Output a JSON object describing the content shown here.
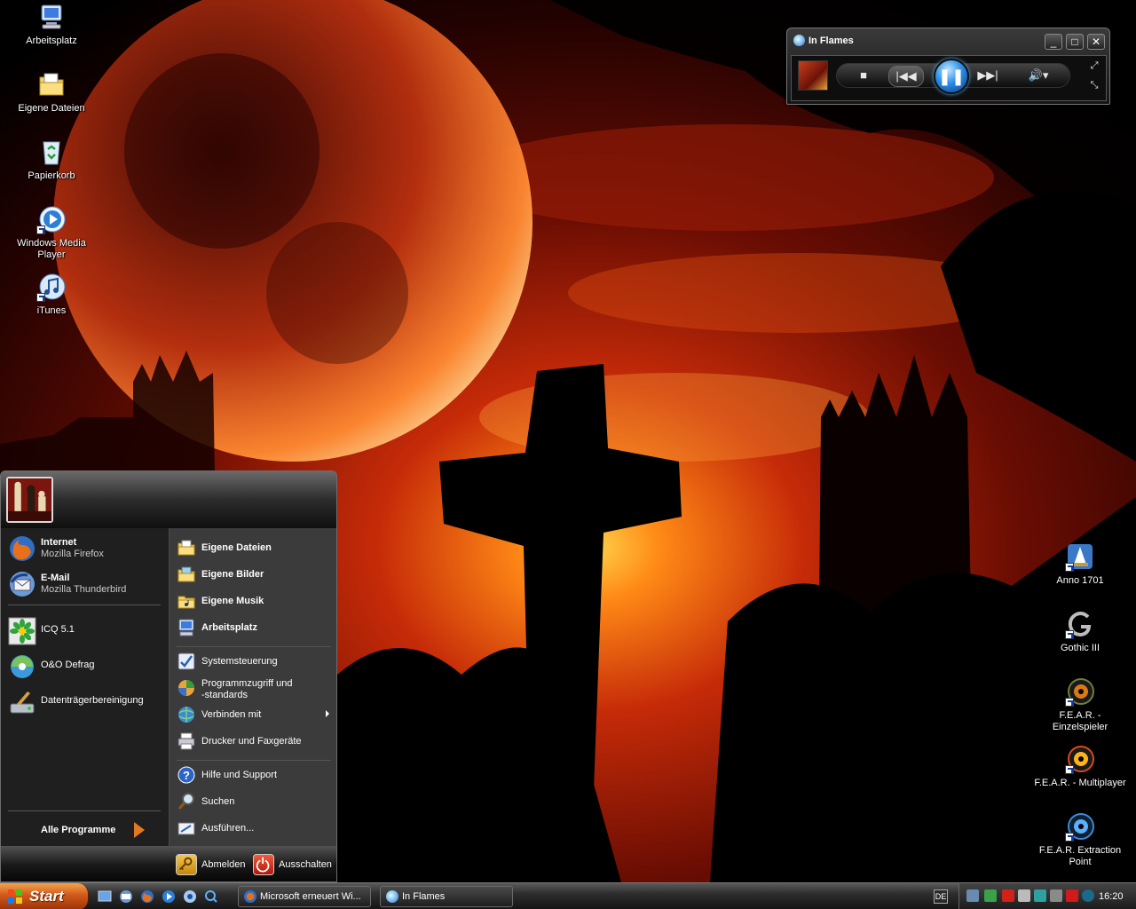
{
  "desktop": {
    "left_icons": [
      {
        "label": "Arbeitsplatz",
        "icon": "my-computer-icon"
      },
      {
        "label": "Eigene Dateien",
        "icon": "my-documents-icon"
      },
      {
        "label": "Papierkorb",
        "icon": "recycle-bin-icon"
      },
      {
        "label": "Windows Media Player",
        "icon": "media-player-icon"
      },
      {
        "label": "iTunes",
        "icon": "itunes-icon"
      }
    ],
    "right_icons": [
      {
        "label": "Anno 1701",
        "icon": "anno-icon"
      },
      {
        "label": "Gothic III",
        "icon": "gothic-icon"
      },
      {
        "label": "F.E.A.R. - Einzelspieler",
        "icon": "fear-icon"
      },
      {
        "label": "F.E.A.R. - Multiplayer",
        "icon": "fear-multiplayer-icon"
      },
      {
        "label": "F.E.A.R. Extraction Point",
        "icon": "fear-extraction-icon"
      }
    ]
  },
  "media_player": {
    "title": "In Flames",
    "window_buttons": {
      "minimize": "_",
      "maximize": "□",
      "close": "✕"
    },
    "state": "playing"
  },
  "start_menu": {
    "pinned": [
      {
        "title": "Internet",
        "subtitle": "Mozilla Firefox",
        "icon": "firefox-icon"
      },
      {
        "title": "E-Mail",
        "subtitle": "Mozilla Thunderbird",
        "icon": "thunderbird-icon"
      }
    ],
    "recent": [
      {
        "label": "ICQ 5.1",
        "icon": "icq-icon"
      },
      {
        "label": "O&O Defrag",
        "icon": "defrag-icon"
      },
      {
        "label": "Datenträgerbereinigung",
        "icon": "disk-cleanup-icon"
      }
    ],
    "all_programs": "Alle Programme",
    "places": [
      {
        "label": "Eigene Dateien",
        "icon": "folder-icon"
      },
      {
        "label": "Eigene Bilder",
        "icon": "pictures-folder-icon"
      },
      {
        "label": "Eigene Musik",
        "icon": "music-folder-icon"
      },
      {
        "label": "Arbeitsplatz",
        "icon": "my-computer-icon"
      }
    ],
    "system": [
      {
        "label": "Systemsteuerung",
        "icon": "control-panel-icon"
      },
      {
        "label_line1": "Programmzugriff und",
        "label_line2": "-standards",
        "icon": "program-access-icon"
      },
      {
        "label": "Verbinden mit",
        "icon": "connect-icon",
        "submenu": true
      },
      {
        "label": "Drucker und Faxgeräte",
        "icon": "printer-icon"
      }
    ],
    "help": [
      {
        "label": "Hilfe und Support",
        "icon": "help-icon"
      },
      {
        "label": "Suchen",
        "icon": "search-icon"
      },
      {
        "label": "Ausführen...",
        "icon": "run-icon"
      }
    ],
    "footer": {
      "logoff": "Abmelden",
      "shutdown": "Ausschalten"
    }
  },
  "taskbar": {
    "start_label": "Start",
    "tasks": [
      {
        "label": "Microsoft erneuert Wi...",
        "icon": "firefox-icon"
      },
      {
        "label": "In Flames",
        "icon": "media-player-icon"
      }
    ],
    "language": "DE",
    "clock": "16:20"
  },
  "colors": {
    "start_orange": "#d0591a",
    "start_menu_left": "#1f1f1f",
    "start_menu_right": "#3b3b3b",
    "wmp_play_blue": "#2b8fe8"
  }
}
